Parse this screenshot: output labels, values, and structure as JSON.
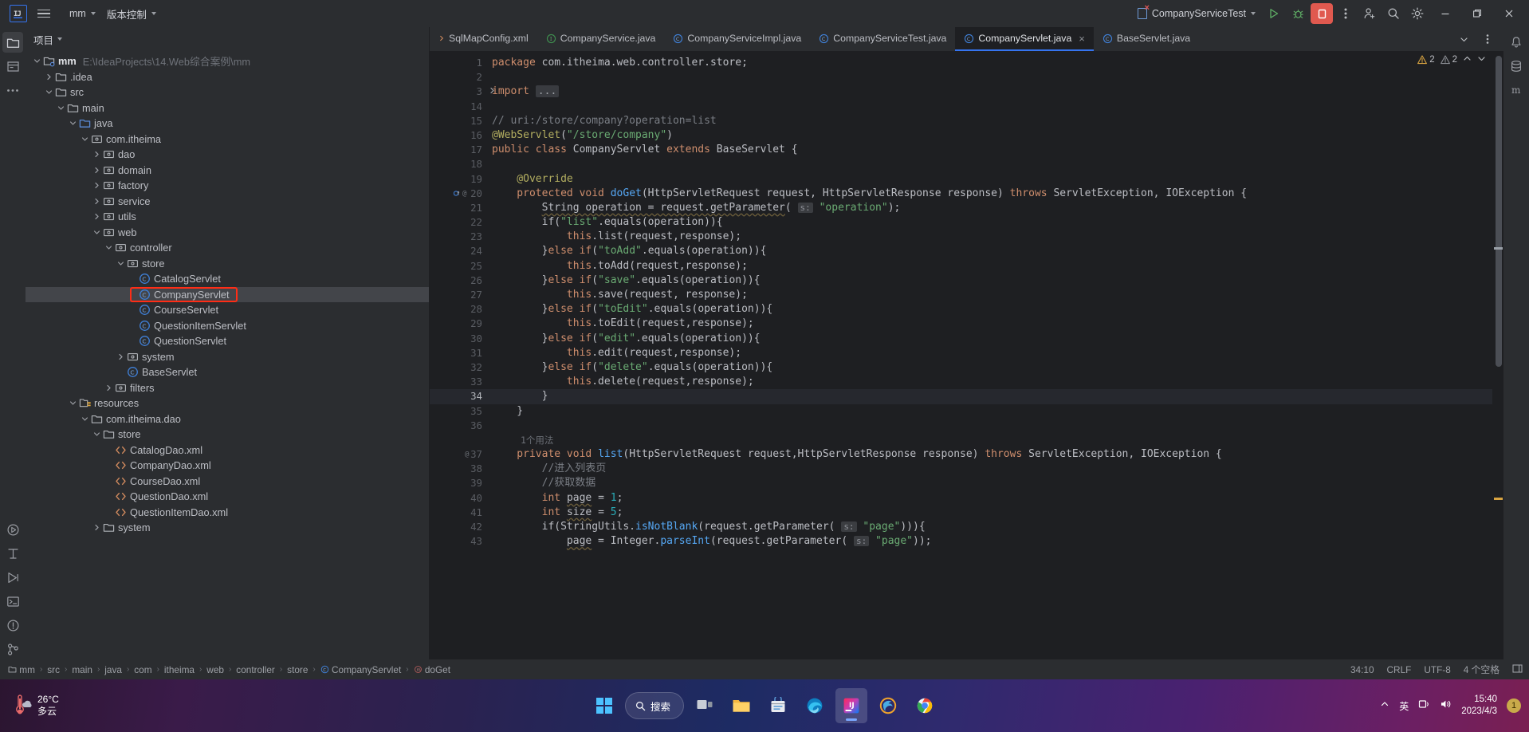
{
  "titlebar": {
    "logo": "IJ",
    "project_menu": "mm",
    "vcs_menu": "版本控制",
    "run_config": "CompanyServiceTest",
    "icons": {
      "hamburger": "hamburger-menu-icon",
      "run": "run-icon",
      "debug": "debug-icon",
      "stop": "stop-icon",
      "more": "more-vertical-icon",
      "share": "add-user-icon",
      "search": "search-icon",
      "settings": "gear-icon",
      "minimize": "minimize-icon",
      "maximize": "maximize-icon",
      "close": "close-icon"
    }
  },
  "project_panel": {
    "title": "项目",
    "tree": [
      {
        "label": "mm",
        "path": "E:\\IdeaProjects\\14.Web综合案例\\mm",
        "depth": 0,
        "arrow": "down",
        "icon": "module-icon",
        "bold": true
      },
      {
        "label": ".idea",
        "depth": 1,
        "arrow": "right",
        "icon": "folder-icon"
      },
      {
        "label": "src",
        "depth": 1,
        "arrow": "down",
        "icon": "folder-icon"
      },
      {
        "label": "main",
        "depth": 2,
        "arrow": "down",
        "icon": "folder-icon"
      },
      {
        "label": "java",
        "depth": 3,
        "arrow": "down",
        "icon": "source-folder-icon"
      },
      {
        "label": "com.itheima",
        "depth": 4,
        "arrow": "down",
        "icon": "package-icon"
      },
      {
        "label": "dao",
        "depth": 5,
        "arrow": "right",
        "icon": "package-icon"
      },
      {
        "label": "domain",
        "depth": 5,
        "arrow": "right",
        "icon": "package-icon"
      },
      {
        "label": "factory",
        "depth": 5,
        "arrow": "right",
        "icon": "package-icon"
      },
      {
        "label": "service",
        "depth": 5,
        "arrow": "right",
        "icon": "package-icon"
      },
      {
        "label": "utils",
        "depth": 5,
        "arrow": "right",
        "icon": "package-icon"
      },
      {
        "label": "web",
        "depth": 5,
        "arrow": "down",
        "icon": "package-icon"
      },
      {
        "label": "controller",
        "depth": 6,
        "arrow": "down",
        "icon": "package-icon"
      },
      {
        "label": "store",
        "depth": 7,
        "arrow": "down",
        "icon": "package-icon"
      },
      {
        "label": "CatalogServlet",
        "depth": 8,
        "arrow": "none",
        "icon": "class-icon"
      },
      {
        "label": "CompanyServlet",
        "depth": 8,
        "arrow": "none",
        "icon": "class-icon",
        "selected": true,
        "highlighted": true
      },
      {
        "label": "CourseServlet",
        "depth": 8,
        "arrow": "none",
        "icon": "class-icon"
      },
      {
        "label": "QuestionItemServlet",
        "depth": 8,
        "arrow": "none",
        "icon": "class-icon"
      },
      {
        "label": "QuestionServlet",
        "depth": 8,
        "arrow": "none",
        "icon": "class-icon"
      },
      {
        "label": "system",
        "depth": 7,
        "arrow": "right",
        "icon": "package-icon"
      },
      {
        "label": "BaseServlet",
        "depth": 7,
        "arrow": "none",
        "icon": "class-icon"
      },
      {
        "label": "filters",
        "depth": 6,
        "arrow": "right",
        "icon": "package-icon"
      },
      {
        "label": "resources",
        "depth": 3,
        "arrow": "down",
        "icon": "resources-folder-icon"
      },
      {
        "label": "com.itheima.dao",
        "depth": 4,
        "arrow": "down",
        "icon": "folder-icon"
      },
      {
        "label": "store",
        "depth": 5,
        "arrow": "down",
        "icon": "folder-icon"
      },
      {
        "label": "CatalogDao.xml",
        "depth": 6,
        "arrow": "none",
        "icon": "xml-icon"
      },
      {
        "label": "CompanyDao.xml",
        "depth": 6,
        "arrow": "none",
        "icon": "xml-icon"
      },
      {
        "label": "CourseDao.xml",
        "depth": 6,
        "arrow": "none",
        "icon": "xml-icon"
      },
      {
        "label": "QuestionDao.xml",
        "depth": 6,
        "arrow": "none",
        "icon": "xml-icon"
      },
      {
        "label": "QuestionItemDao.xml",
        "depth": 6,
        "arrow": "none",
        "icon": "xml-icon"
      },
      {
        "label": "system",
        "depth": 5,
        "arrow": "right",
        "icon": "folder-icon"
      }
    ]
  },
  "editor": {
    "tabs": [
      {
        "label": "SqlMapConfig.xml",
        "icon": "xml-icon",
        "active": false,
        "partial": true
      },
      {
        "label": "CompanyService.java",
        "icon": "interface-icon",
        "active": false
      },
      {
        "label": "CompanyServiceImpl.java",
        "icon": "class-icon",
        "active": false
      },
      {
        "label": "CompanyServiceTest.java",
        "icon": "class-icon",
        "active": false
      },
      {
        "label": "CompanyServlet.java",
        "icon": "class-icon",
        "active": true,
        "closable": true
      },
      {
        "label": "BaseServlet.java",
        "icon": "class-icon",
        "active": false
      }
    ],
    "inspections": {
      "warnings": "2",
      "weak_warnings": "2"
    },
    "lines": [
      {
        "n": "1",
        "tokens": [
          {
            "t": "package ",
            "c": "kw"
          },
          {
            "t": "com.itheima.web.controller.store;",
            "c": "plain"
          }
        ]
      },
      {
        "n": "2",
        "tokens": []
      },
      {
        "n": "3",
        "fold": "right",
        "tokens": [
          {
            "t": "import ",
            "c": "kw"
          },
          {
            "t": "...",
            "c": "foldph"
          }
        ]
      },
      {
        "n": "14",
        "tokens": []
      },
      {
        "n": "15",
        "tokens": [
          {
            "t": "// uri:/store/company?operation=list",
            "c": "cmt"
          }
        ]
      },
      {
        "n": "16",
        "tokens": [
          {
            "t": "@WebServlet",
            "c": "ann"
          },
          {
            "t": "(",
            "c": "plain"
          },
          {
            "t": "\"/store/company\"",
            "c": "str"
          },
          {
            "t": ")",
            "c": "plain"
          }
        ]
      },
      {
        "n": "17",
        "tokens": [
          {
            "t": "public class ",
            "c": "kw"
          },
          {
            "t": "CompanyServlet ",
            "c": "plain"
          },
          {
            "t": "extends ",
            "c": "kw"
          },
          {
            "t": "BaseServlet {",
            "c": "plain"
          }
        ]
      },
      {
        "n": "18",
        "tokens": []
      },
      {
        "n": "19",
        "tokens": [
          {
            "t": "    @Override",
            "c": "ann"
          }
        ]
      },
      {
        "n": "20",
        "gutter": "override-impl",
        "tokens": [
          {
            "t": "    protected void ",
            "c": "kw"
          },
          {
            "t": "doGet",
            "c": "mth"
          },
          {
            "t": "(HttpServletRequest request, HttpServletResponse response) ",
            "c": "plain"
          },
          {
            "t": "throws ",
            "c": "kw"
          },
          {
            "t": "ServletException, IOException {",
            "c": "plain"
          }
        ]
      },
      {
        "n": "21",
        "tokens": [
          {
            "t": "        ",
            "c": "plain"
          },
          {
            "t": "String operation = request.getParameter",
            "c": "wavy"
          },
          {
            "t": "( ",
            "c": "plain"
          },
          {
            "t": "s:",
            "c": "hint"
          },
          {
            "t": " ",
            "c": "plain"
          },
          {
            "t": "\"operation\"",
            "c": "str"
          },
          {
            "t": ");",
            "c": "plain"
          }
        ]
      },
      {
        "n": "22",
        "tokens": [
          {
            "t": "        if(",
            "c": "plain"
          },
          {
            "t": "\"list\"",
            "c": "str"
          },
          {
            "t": ".equals(operation)){",
            "c": "plain"
          }
        ]
      },
      {
        "n": "23",
        "tokens": [
          {
            "t": "            ",
            "c": "plain"
          },
          {
            "t": "this",
            "c": "kw"
          },
          {
            "t": ".list(request,response);",
            "c": "plain"
          }
        ]
      },
      {
        "n": "24",
        "tokens": [
          {
            "t": "        }",
            "c": "plain"
          },
          {
            "t": "else if",
            "c": "kw"
          },
          {
            "t": "(",
            "c": "plain"
          },
          {
            "t": "\"toAdd\"",
            "c": "str"
          },
          {
            "t": ".equals(operation)){",
            "c": "plain"
          }
        ]
      },
      {
        "n": "25",
        "tokens": [
          {
            "t": "            ",
            "c": "plain"
          },
          {
            "t": "this",
            "c": "kw"
          },
          {
            "t": ".toAdd(request,response);",
            "c": "plain"
          }
        ]
      },
      {
        "n": "26",
        "tokens": [
          {
            "t": "        }",
            "c": "plain"
          },
          {
            "t": "else if",
            "c": "kw"
          },
          {
            "t": "(",
            "c": "plain"
          },
          {
            "t": "\"save\"",
            "c": "str"
          },
          {
            "t": ".equals(operation)){",
            "c": "plain"
          }
        ]
      },
      {
        "n": "27",
        "tokens": [
          {
            "t": "            ",
            "c": "plain"
          },
          {
            "t": "this",
            "c": "kw"
          },
          {
            "t": ".save(request, response);",
            "c": "plain"
          }
        ]
      },
      {
        "n": "28",
        "tokens": [
          {
            "t": "        }",
            "c": "plain"
          },
          {
            "t": "else if",
            "c": "kw"
          },
          {
            "t": "(",
            "c": "plain"
          },
          {
            "t": "\"toEdit\"",
            "c": "str"
          },
          {
            "t": ".equals(operation)){",
            "c": "plain"
          }
        ]
      },
      {
        "n": "29",
        "tokens": [
          {
            "t": "            ",
            "c": "plain"
          },
          {
            "t": "this",
            "c": "kw"
          },
          {
            "t": ".toEdit(request,response);",
            "c": "plain"
          }
        ]
      },
      {
        "n": "30",
        "tokens": [
          {
            "t": "        }",
            "c": "plain"
          },
          {
            "t": "else if",
            "c": "kw"
          },
          {
            "t": "(",
            "c": "plain"
          },
          {
            "t": "\"edit\"",
            "c": "str"
          },
          {
            "t": ".equals(operation)){",
            "c": "plain"
          }
        ]
      },
      {
        "n": "31",
        "tokens": [
          {
            "t": "            ",
            "c": "plain"
          },
          {
            "t": "this",
            "c": "kw"
          },
          {
            "t": ".edit(request,response);",
            "c": "plain"
          }
        ]
      },
      {
        "n": "32",
        "tokens": [
          {
            "t": "        }",
            "c": "plain"
          },
          {
            "t": "else if",
            "c": "kw"
          },
          {
            "t": "(",
            "c": "plain"
          },
          {
            "t": "\"delete\"",
            "c": "str"
          },
          {
            "t": ".equals(operation))",
            "c": "plain"
          },
          {
            "t": "{",
            "c": "brace"
          }
        ]
      },
      {
        "n": "33",
        "tokens": [
          {
            "t": "            ",
            "c": "plain"
          },
          {
            "t": "this",
            "c": "kw"
          },
          {
            "t": ".delete(request,response);",
            "c": "plain"
          }
        ]
      },
      {
        "n": "34",
        "current": true,
        "tokens": [
          {
            "t": "        ",
            "c": "plain"
          },
          {
            "t": "}",
            "c": "brace"
          }
        ]
      },
      {
        "n": "35",
        "tokens": [
          {
            "t": "    }",
            "c": "plain"
          }
        ]
      },
      {
        "n": "36",
        "tokens": []
      },
      {
        "n": "",
        "usage": "1个用法",
        "tokens": []
      },
      {
        "n": "37",
        "gutter": "usage",
        "tokens": [
          {
            "t": "    private void ",
            "c": "kw"
          },
          {
            "t": "list",
            "c": "mth"
          },
          {
            "t": "(HttpServletRequest request,HttpServletResponse response) ",
            "c": "plain"
          },
          {
            "t": "throws ",
            "c": "kw"
          },
          {
            "t": "ServletException, IOException {",
            "c": "plain"
          }
        ]
      },
      {
        "n": "38",
        "tokens": [
          {
            "t": "        //进入列表页",
            "c": "cmt"
          }
        ]
      },
      {
        "n": "39",
        "tokens": [
          {
            "t": "        //获取数据",
            "c": "cmt"
          }
        ]
      },
      {
        "n": "40",
        "tokens": [
          {
            "t": "        ",
            "c": "plain"
          },
          {
            "t": "int ",
            "c": "kw"
          },
          {
            "t": "page",
            "c": "wavy"
          },
          {
            "t": " = ",
            "c": "plain"
          },
          {
            "t": "1",
            "c": "num"
          },
          {
            "t": ";",
            "c": "plain"
          }
        ]
      },
      {
        "n": "41",
        "tokens": [
          {
            "t": "        ",
            "c": "plain"
          },
          {
            "t": "int ",
            "c": "kw"
          },
          {
            "t": "size",
            "c": "wavy"
          },
          {
            "t": " = ",
            "c": "plain"
          },
          {
            "t": "5",
            "c": "num"
          },
          {
            "t": ";",
            "c": "plain"
          }
        ]
      },
      {
        "n": "42",
        "tokens": [
          {
            "t": "        if(StringUtils.",
            "c": "plain"
          },
          {
            "t": "isNotBlank",
            "c": "mthi"
          },
          {
            "t": "(request.getParameter( ",
            "c": "plain"
          },
          {
            "t": "s:",
            "c": "hint"
          },
          {
            "t": " ",
            "c": "plain"
          },
          {
            "t": "\"page\"",
            "c": "str"
          },
          {
            "t": "))){",
            "c": "plain"
          }
        ]
      },
      {
        "n": "43",
        "tokens": [
          {
            "t": "            ",
            "c": "plain"
          },
          {
            "t": "page",
            "c": "wavy"
          },
          {
            "t": " = Integer.",
            "c": "plain"
          },
          {
            "t": "parseInt",
            "c": "mthi"
          },
          {
            "t": "(request.getParameter( ",
            "c": "plain"
          },
          {
            "t": "s:",
            "c": "hint"
          },
          {
            "t": " ",
            "c": "plain"
          },
          {
            "t": "\"page\"",
            "c": "str"
          },
          {
            "t": "));",
            "c": "plain"
          }
        ]
      }
    ]
  },
  "status_bar": {
    "breadcrumbs": [
      "mm",
      "src",
      "main",
      "java",
      "com",
      "itheima",
      "web",
      "controller",
      "store",
      "CompanyServlet",
      "doGet"
    ],
    "caret": "34:10",
    "line_separator": "CRLF",
    "encoding": "UTF-8",
    "indent": "4 个空格"
  },
  "taskbar": {
    "weather_temp": "26°C",
    "weather_desc": "多云",
    "search_placeholder": "搜索",
    "time": "15:40",
    "date": "2023/4/3",
    "language": "英",
    "notification_count": "1",
    "icons": {
      "start": "windows-start-icon",
      "search": "search-icon",
      "taskview": "task-view-icon",
      "explorer": "file-explorer-icon",
      "store": "microsoft-store-icon",
      "edge": "edge-browser-icon",
      "idea": "intellij-idea-icon",
      "firefox": "firefox-icon",
      "chrome": "chrome-icon",
      "chevron": "chevron-up-icon",
      "ime": "ime-icon",
      "network": "network-icon",
      "volume": "volume-icon"
    }
  },
  "colors": {
    "accent": "#3574f0",
    "annotation_box": "#ff2d16",
    "stop_button": "#e0594f",
    "run_green": "#5fad65",
    "string_green": "#6aab73",
    "keyword_orange": "#cf8e6d"
  }
}
